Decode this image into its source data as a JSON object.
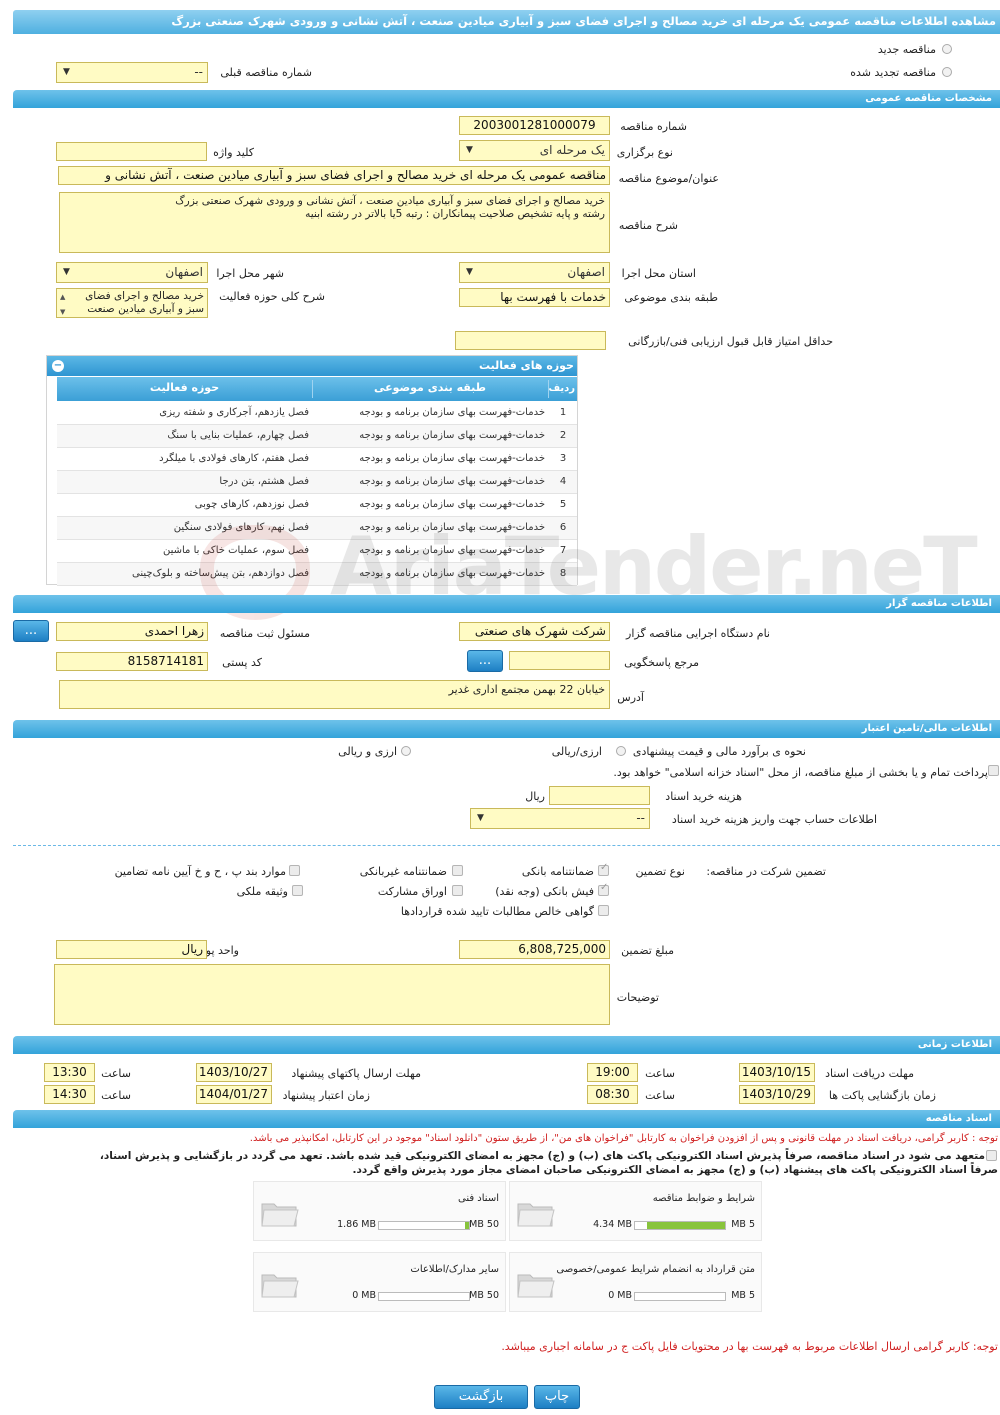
{
  "title": "مشاهده اطلاعات مناقصه عمومی یک مرحله ای خرید مصالح و اجرای فضای سبز و آبیاری میادین صنعت ، آتش نشانی و ورودی شهرک صنعتی بزرگ",
  "top": {
    "new_tender": "مناقصه جدید",
    "renewed_tender": "مناقصه تجدید شده",
    "prev_number_label": "شماره مناقصه قبلی",
    "prev_number_value": "--"
  },
  "general": {
    "header": "مشخصات مناقصه عمومی",
    "number_label": "شماره مناقصه",
    "number_value": "2003001281000079",
    "type_label": "نوع برگزاری",
    "type_value": "یک مرحله ای",
    "keyword_label": "کلید واژه",
    "keyword_value": "",
    "subject_label": "عنوان/موضوع مناقصه",
    "subject_value": "مناقصه عمومی یک مرحله ای خرید مصالح و اجرای فضای سبز و آبیاری میادین صنعت ، آتش نشانی و",
    "desc_label": "شرح مناقصه",
    "desc_line1": "خرید مصالح و اجرای فضای سبز و آبیاری میادین صنعت ، آتش نشانی و ورودی شهرک صنعتی بزرگ",
    "desc_line2": "رشته و پایه تشخیص صلاحیت پیمانکاران : رتبه 5یا بالاتر در رشته ابنیه",
    "province_label": "استان محل اجرا",
    "province_value": "اصفهان",
    "city_label": "شهر محل اجرا",
    "city_value": "اصفهان",
    "category_label": "طبقه بندی موضوعی",
    "category_value": "خدمات با فهرست بها",
    "activity_label": "شرح کلی حوزه فعالیت",
    "activity_line1": "خرید مصالح و اجرای فضای",
    "activity_line2": "سبز و آبیاری میادین صنعت",
    "min_score_label": "حداقل امتیاز قابل قبول ارزیابی فنی/بازرگانی",
    "min_score_value": ""
  },
  "activity_table": {
    "header": "حوزه های فعالیت",
    "col_row": "ردیف",
    "col_category": "طبقه بندی موضوعی",
    "col_field": "حوزه فعالیت",
    "rows": [
      {
        "n": "1",
        "cat": "خدمات-فهرست بهای سازمان برنامه و بودجه",
        "field": "فصل یازدهم، آجرکاری و شفته ریزی"
      },
      {
        "n": "2",
        "cat": "خدمات-فهرست بهای سازمان برنامه و بودجه",
        "field": "فصل چهارم، عملیات بنایی با سنگ"
      },
      {
        "n": "3",
        "cat": "خدمات-فهرست بهای سازمان برنامه و بودجه",
        "field": "فصل هفتم، کارهای فولادی با میلگرد"
      },
      {
        "n": "4",
        "cat": "خدمات-فهرست بهای سازمان برنامه و بودجه",
        "field": "فصل هشتم، بتن درجا"
      },
      {
        "n": "5",
        "cat": "خدمات-فهرست بهای سازمان برنامه و بودجه",
        "field": "فصل نوزدهم، کارهای چوبی"
      },
      {
        "n": "6",
        "cat": "خدمات-فهرست بهای سازمان برنامه و بودجه",
        "field": "فصل نهم، کارهای فولادی سنگین"
      },
      {
        "n": "7",
        "cat": "خدمات-فهرست بهای سازمان برنامه و بودجه",
        "field": "فصل سوم، عملیات خاکی با ماشین"
      },
      {
        "n": "8",
        "cat": "خدمات-فهرست بهای سازمان برنامه و بودجه",
        "field": "فصل دوازدهم، بتن پیش‌ساخته و بلوک‌چینی"
      }
    ]
  },
  "organizer": {
    "header": "اطلاعات مناقصه گزار",
    "org_label": "نام دستگاه اجرایی مناقصه گزار",
    "org_value": "شرکت شهرک های صنعتی",
    "registrar_label": "مسئول ثبت مناقصه",
    "registrar_value": "زهرا احمدی",
    "ref_label": "مرجع پاسخگویی",
    "ref_value": "",
    "postal_label": "کد پستی",
    "postal_value": "8158714181",
    "address_label": "آدرس",
    "address_value": "خیابان 22 بهمن مجتمع اداری غدیر",
    "dots": "..."
  },
  "finance": {
    "header": "اطلاعات مالی/تامین اعتبار",
    "estimate_label": "نحوه ی برآورد مالی و قیمت پیشنهادی",
    "opt_rial": "ارزی/ریالی",
    "opt_fx": "ارزی و ریالی",
    "treasury_text": "پرداخت تمام و یا بخشی از مبلغ مناقصه، از محل \"اسناد خزانه اسلامی\" خواهد بود.",
    "doc_cost_label": "هزینه خرید اسناد",
    "doc_cost_unit": "ریال",
    "doc_cost_value": "",
    "account_label": "اطلاعات حساب جهت واریز هزینه خرید اسناد",
    "account_value": "--"
  },
  "guarantee": {
    "title": "تضمین شرکت در مناقصه:",
    "type_label": "نوع تضمین",
    "opt1": "ضمانتنامه بانکی",
    "opt2": "ضمانتنامه غیربانکی",
    "opt3": "موارد بند پ ، ح و خ آیین نامه تضامین",
    "opt4": "فیش بانکی (وجه نقد)",
    "opt5": "اوراق مشارکت",
    "opt6": "وثیقه ملکی",
    "opt7": "گواهی خالص مطالبات تایید شده قراردادها",
    "amount_label": "مبلغ تضمین",
    "amount_value": "6,808,725,000",
    "currency_label": "واحد پول",
    "currency_value": "ریال",
    "notes_label": "توضیحات",
    "notes_value": ""
  },
  "timing": {
    "header": "اطلاعات زمانی",
    "receive_label": "مهلت دریافت اسناد",
    "receive_date": "1403/10/15",
    "receive_time": "19:00",
    "send_label": "مهلت ارسال پاکتهای پیشنهاد",
    "send_date": "1403/10/27",
    "send_time": "13:30",
    "open_label": "زمان بازگشایی پاکت ها",
    "open_date": "1403/10/29",
    "open_time": "08:30",
    "valid_label": "زمان اعتبار پیشنهاد",
    "valid_date": "1404/01/27",
    "valid_time": "14:30",
    "time_word": "ساعت"
  },
  "docs": {
    "header": "اسناد مناقصه",
    "note1": "توجه : کاربر گرامی، دریافت اسناد در مهلت قانونی و پس از افزودن فراخوان به کارتابل \"فراخوان های من\"، از طریق ستون \"دانلود اسناد\" موجود در این کارتابل، امکانپذیر می باشد.",
    "note2a": "متعهد می شود در اسناد مناقصه، صرفاً پذیرش اسناد الکترونیکی پاکت های (ب) و (ج) مجهز به امضای الکترونیکی قید شده باشد. تعهد می گردد در بازگشایی و پذیرش اسناد،",
    "note2b": "صرفاً اسناد الکترونیکی پاکت های پیشنهاد (ب) و (ج) مجهز به امضای الکترونیکی صاحبان امضای مجاز مورد پذیرش واقع گردد.",
    "items": [
      {
        "name": "شرایط و ضوابط مناقصه",
        "size": "4.34 MB",
        "max": "5 MB",
        "pct": 0.87
      },
      {
        "name": "اسناد فنی",
        "size": "1.86 MB",
        "max": "50 MB",
        "pct": 0.04
      },
      {
        "name": "متن قرارداد به انضمام شرایط عمومی/خصوصی",
        "size": "0 MB",
        "max": "5 MB",
        "pct": 0
      },
      {
        "name": "سایر مدارک/اطلاعات",
        "size": "0 MB",
        "max": "50 MB",
        "pct": 0
      }
    ],
    "note3": "توجه: کاربر گرامی ارسال اطلاعات مربوط به فهرست بها در محتویات فایل پاکت ج در سامانه اجباری میباشد."
  },
  "buttons": {
    "print": "چاپ",
    "back": "بازگشت"
  },
  "watermark": "AriaTender.neT"
}
